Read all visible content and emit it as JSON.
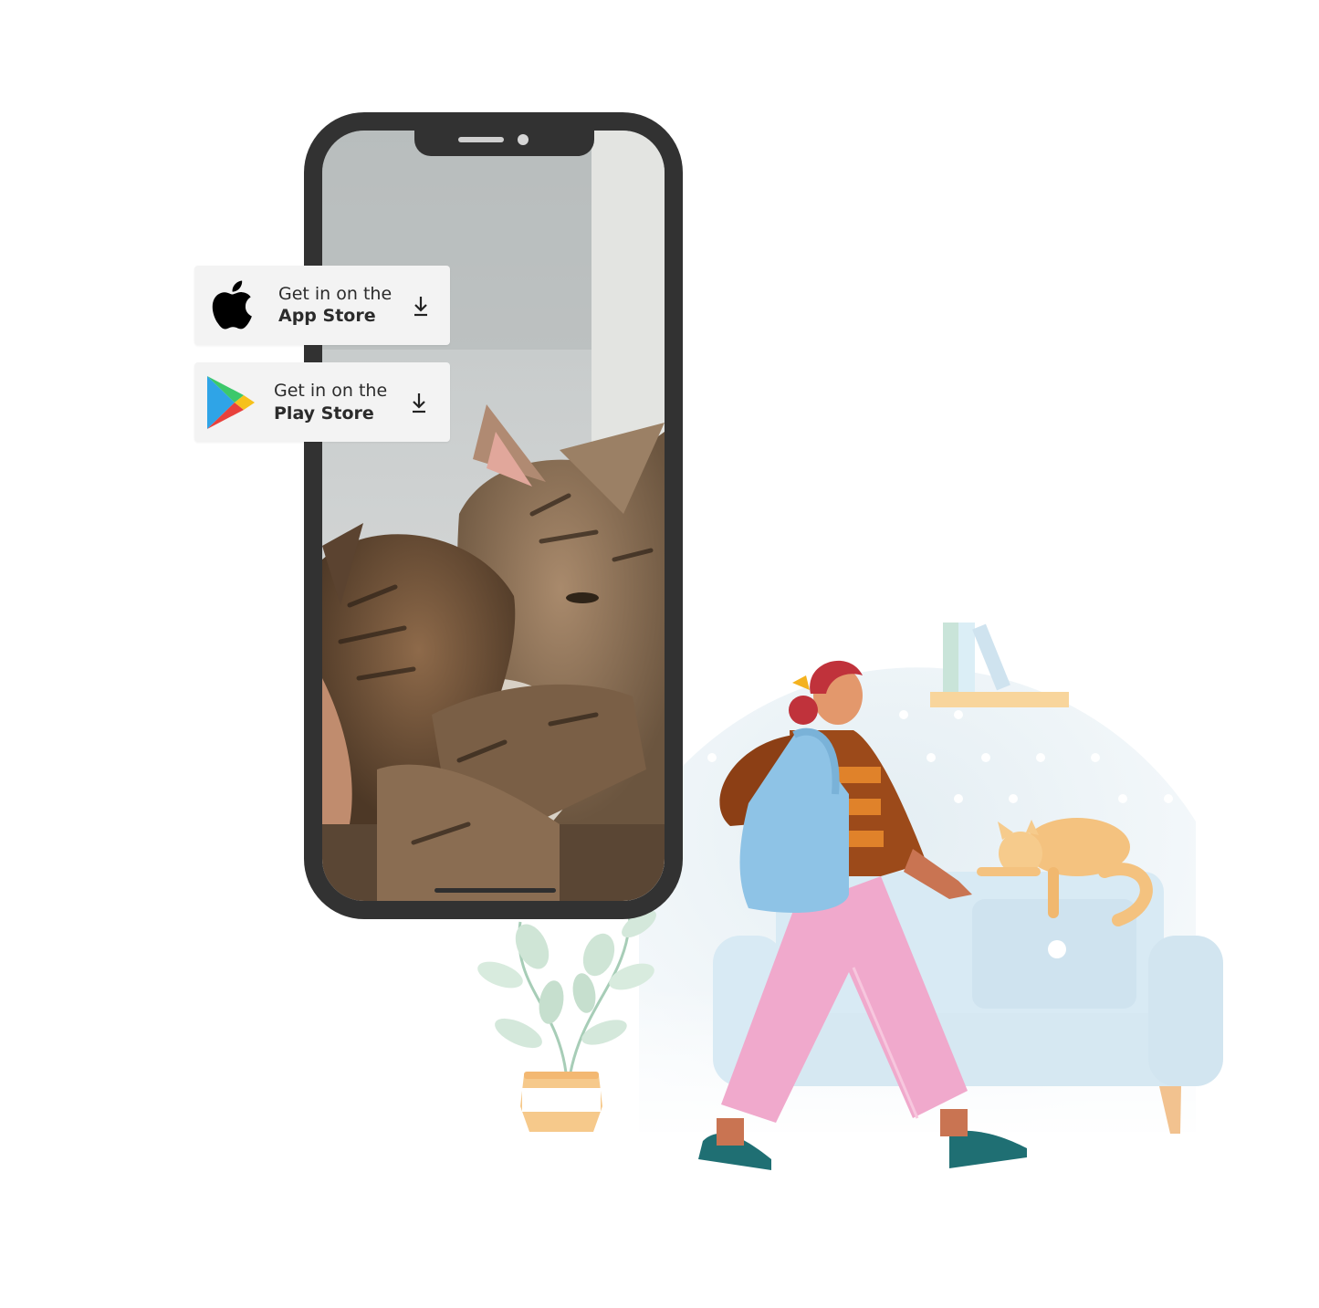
{
  "stores": [
    {
      "pre_label": "Get in on the",
      "name": "App Store",
      "icon": "apple-logo-icon"
    },
    {
      "pre_label": "Get in on the",
      "name": "Play Store",
      "icon": "google-play-logo-icon"
    }
  ],
  "icons": {
    "download": "download-icon"
  },
  "colors": {
    "phone_frame": "#323232",
    "card_bg": "#f3f3f3",
    "text": "#2b2b2b",
    "room_bg": "#e9f1f5",
    "sofa": "#d6e8f2",
    "pants": "#f0a9cc",
    "bag": "#8ec3e6",
    "cat": "#f4c27f",
    "plant_leaf": "#cfe5d6",
    "pot": "#f6c98b"
  }
}
